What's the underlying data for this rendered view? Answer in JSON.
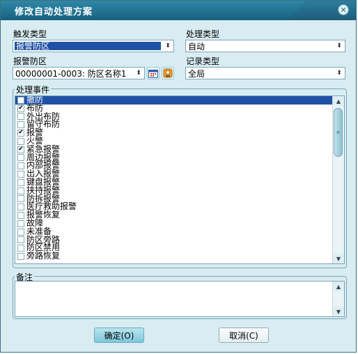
{
  "window": {
    "title": "修改自动处理方案",
    "close_glyph": "✕"
  },
  "form": {
    "trigger_type": {
      "label": "触发类型",
      "value": "报警防区"
    },
    "handle_type": {
      "label": "处理类型",
      "value": "自动"
    },
    "alarm_zone": {
      "label": "报警防区",
      "value": "00000001-0003: 防区名称1"
    },
    "record_type": {
      "label": "记录类型",
      "value": "全局"
    }
  },
  "events": {
    "group_label": "处理事件",
    "items": [
      {
        "label": "撤防",
        "checked": false,
        "selected": true
      },
      {
        "label": "布防",
        "checked": true
      },
      {
        "label": "外出布防",
        "checked": false
      },
      {
        "label": "留守布防",
        "checked": false
      },
      {
        "label": "报警",
        "checked": true
      },
      {
        "label": "火警",
        "checked": false
      },
      {
        "label": "紧急报警",
        "checked": true
      },
      {
        "label": "周边报警",
        "checked": false
      },
      {
        "label": "内部报警",
        "checked": false
      },
      {
        "label": "出入报警",
        "checked": false
      },
      {
        "label": "键盘报警",
        "checked": false
      },
      {
        "label": "挟持报警",
        "checked": false
      },
      {
        "label": "防拆报警",
        "checked": false
      },
      {
        "label": "医疗救助报警",
        "checked": false
      },
      {
        "label": "报警恢复",
        "checked": false
      },
      {
        "label": "故障",
        "checked": false
      },
      {
        "label": "未准备",
        "checked": false
      },
      {
        "label": "防区旁路",
        "checked": false
      },
      {
        "label": "防区禁用",
        "checked": false
      },
      {
        "label": "旁路恢复",
        "checked": false
      }
    ]
  },
  "notes": {
    "label": "备注",
    "value": ""
  },
  "buttons": {
    "ok": "确定(O)",
    "cancel": "取消(C)"
  },
  "icons": {
    "calendar": "calendar-icon",
    "zone_picker": "zone-picker-icon",
    "dropdown": "chevron-down-icon",
    "check": "✔"
  },
  "colors": {
    "titlebar": "#1c5c79",
    "selection": "#1e52a6",
    "background": "#d8ecf2"
  }
}
